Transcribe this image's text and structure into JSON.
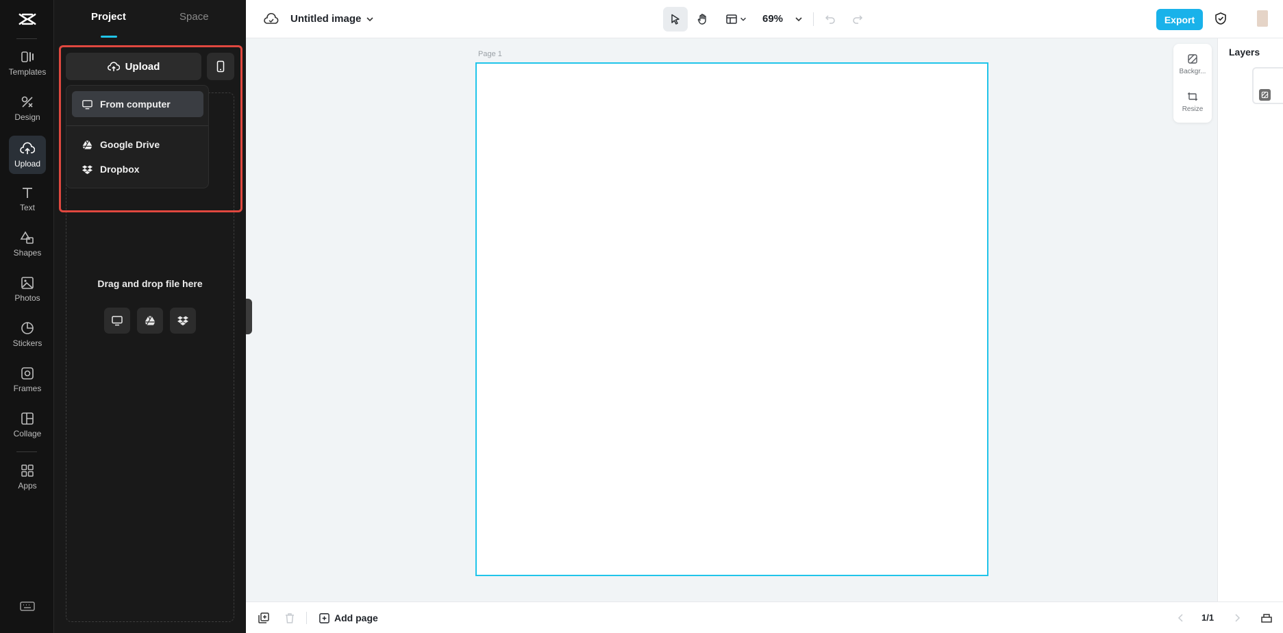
{
  "rail": {
    "items": [
      {
        "label": "Templates",
        "icon": "templates-icon"
      },
      {
        "label": "Design",
        "icon": "design-icon"
      },
      {
        "label": "Upload",
        "icon": "upload-cloud-icon",
        "active": true
      },
      {
        "label": "Text",
        "icon": "text-icon"
      },
      {
        "label": "Shapes",
        "icon": "shapes-icon"
      },
      {
        "label": "Photos",
        "icon": "photos-icon"
      },
      {
        "label": "Stickers",
        "icon": "stickers-icon"
      },
      {
        "label": "Frames",
        "icon": "frames-icon"
      },
      {
        "label": "Collage",
        "icon": "collage-icon"
      },
      {
        "label": "Apps",
        "icon": "apps-icon"
      }
    ]
  },
  "panel": {
    "tabs": [
      {
        "label": "Project",
        "active": true
      },
      {
        "label": "Space",
        "active": false
      }
    ],
    "upload_label": "Upload",
    "menu": {
      "items": [
        {
          "label": "From computer",
          "icon": "monitor-icon"
        },
        {
          "label": "Google Drive",
          "icon": "google-drive-icon"
        },
        {
          "label": "Dropbox",
          "icon": "dropbox-icon"
        }
      ]
    },
    "dropzone_text": "Drag and drop file here"
  },
  "topbar": {
    "title": "Untitled image",
    "zoom": "69%",
    "export_label": "Export"
  },
  "canvas": {
    "page_label": "Page 1"
  },
  "mini_tools": [
    {
      "label": "Backgr...",
      "icon": "background-icon"
    },
    {
      "label": "Resize",
      "icon": "resize-icon"
    }
  ],
  "layers": {
    "title": "Layers"
  },
  "bottombar": {
    "add_page_label": "Add page",
    "page_count": "1/1"
  },
  "colors": {
    "accent": "#19b2ea",
    "selection": "#1fc4ea",
    "highlight": "#e0483f",
    "rail_bg": "#131313",
    "panel_bg": "#191919"
  }
}
